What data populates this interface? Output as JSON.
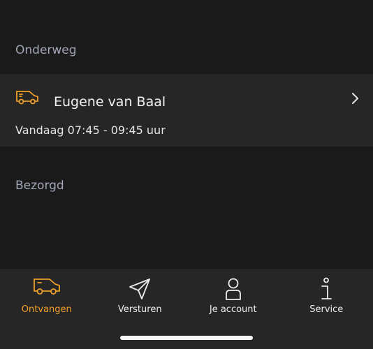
{
  "sections": {
    "onderweg": "Onderweg",
    "bezorgd": "Bezorgd"
  },
  "delivery": {
    "name": "Eugene van Baal",
    "time": "Vandaag 07:45 - 09:45 uur",
    "icon": "van-icon"
  },
  "tabs": [
    {
      "label": "Ontvangen",
      "icon": "van-icon",
      "active": true
    },
    {
      "label": "Versturen",
      "icon": "send-icon",
      "active": false
    },
    {
      "label": "Je account",
      "icon": "person-icon",
      "active": false
    },
    {
      "label": "Service",
      "icon": "info-icon",
      "active": false
    }
  ],
  "colors": {
    "accent": "#f0a02a",
    "background": "#1a1a1a",
    "card": "#262626",
    "muted_text": "#a0a6b4"
  }
}
